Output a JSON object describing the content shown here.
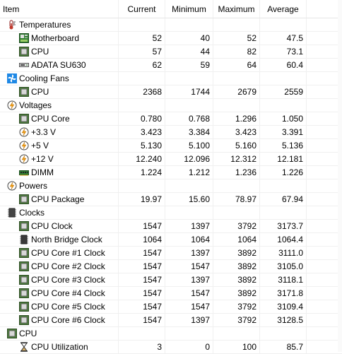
{
  "columns": {
    "item": "Item",
    "current": "Current",
    "minimum": "Minimum",
    "maximum": "Maximum",
    "average": "Average"
  },
  "rows": [
    {
      "type": "group",
      "icon": "thermometer-icon",
      "label": "Temperatures"
    },
    {
      "type": "item",
      "icon": "motherboard-icon",
      "label": "Motherboard",
      "current": "52",
      "minimum": "40",
      "maximum": "52",
      "average": "47.5"
    },
    {
      "type": "item",
      "icon": "cpu-chip-icon",
      "label": "CPU",
      "current": "57",
      "minimum": "44",
      "maximum": "82",
      "average": "73.1"
    },
    {
      "type": "item",
      "icon": "drive-icon",
      "label": "ADATA SU630",
      "current": "62",
      "minimum": "59",
      "maximum": "64",
      "average": "60.4"
    },
    {
      "type": "group",
      "icon": "fan-icon",
      "label": "Cooling Fans"
    },
    {
      "type": "item",
      "icon": "cpu-chip-icon",
      "label": "CPU",
      "current": "2368",
      "minimum": "1744",
      "maximum": "2679",
      "average": "2559"
    },
    {
      "type": "group",
      "icon": "voltage-icon",
      "label": "Voltages"
    },
    {
      "type": "item",
      "icon": "cpu-chip-icon",
      "label": "CPU Core",
      "current": "0.780",
      "minimum": "0.768",
      "maximum": "1.296",
      "average": "1.050"
    },
    {
      "type": "item",
      "icon": "voltage-icon",
      "label": "+3.3 V",
      "current": "3.423",
      "minimum": "3.384",
      "maximum": "3.423",
      "average": "3.391"
    },
    {
      "type": "item",
      "icon": "voltage-icon",
      "label": "+5 V",
      "current": "5.130",
      "minimum": "5.100",
      "maximum": "5.160",
      "average": "5.136"
    },
    {
      "type": "item",
      "icon": "voltage-icon",
      "label": "+12 V",
      "current": "12.240",
      "minimum": "12.096",
      "maximum": "12.312",
      "average": "12.181"
    },
    {
      "type": "item",
      "icon": "dimm-icon",
      "label": "DIMM",
      "current": "1.224",
      "minimum": "1.212",
      "maximum": "1.236",
      "average": "1.226"
    },
    {
      "type": "group",
      "icon": "voltage-icon",
      "label": "Powers"
    },
    {
      "type": "item",
      "icon": "cpu-chip-icon",
      "label": "CPU Package",
      "current": "19.97",
      "minimum": "15.60",
      "maximum": "78.97",
      "average": "67.94"
    },
    {
      "type": "group",
      "icon": "clock-chip-icon",
      "label": "Clocks"
    },
    {
      "type": "item",
      "icon": "cpu-chip-icon",
      "label": "CPU Clock",
      "current": "1547",
      "minimum": "1397",
      "maximum": "3792",
      "average": "3173.7"
    },
    {
      "type": "item",
      "icon": "northbridge-icon",
      "label": "North Bridge Clock",
      "current": "1064",
      "minimum": "1064",
      "maximum": "1064",
      "average": "1064.4"
    },
    {
      "type": "item",
      "icon": "cpu-chip-icon",
      "label": "CPU Core #1 Clock",
      "current": "1547",
      "minimum": "1397",
      "maximum": "3892",
      "average": "3111.0"
    },
    {
      "type": "item",
      "icon": "cpu-chip-icon",
      "label": "CPU Core #2 Clock",
      "current": "1547",
      "minimum": "1547",
      "maximum": "3892",
      "average": "3105.0"
    },
    {
      "type": "item",
      "icon": "cpu-chip-icon",
      "label": "CPU Core #3 Clock",
      "current": "1547",
      "minimum": "1397",
      "maximum": "3892",
      "average": "3118.1"
    },
    {
      "type": "item",
      "icon": "cpu-chip-icon",
      "label": "CPU Core #4 Clock",
      "current": "1547",
      "minimum": "1547",
      "maximum": "3892",
      "average": "3171.8"
    },
    {
      "type": "item",
      "icon": "cpu-chip-icon",
      "label": "CPU Core #5 Clock",
      "current": "1547",
      "minimum": "1547",
      "maximum": "3792",
      "average": "3109.4"
    },
    {
      "type": "item",
      "icon": "cpu-chip-icon",
      "label": "CPU Core #6 Clock",
      "current": "1547",
      "minimum": "1397",
      "maximum": "3792",
      "average": "3128.5"
    },
    {
      "type": "group",
      "icon": "cpu-chip-icon",
      "label": "CPU"
    },
    {
      "type": "item",
      "icon": "hourglass-icon",
      "label": "CPU Utilization",
      "current": "3",
      "minimum": "0",
      "maximum": "100",
      "average": "85.7"
    }
  ]
}
